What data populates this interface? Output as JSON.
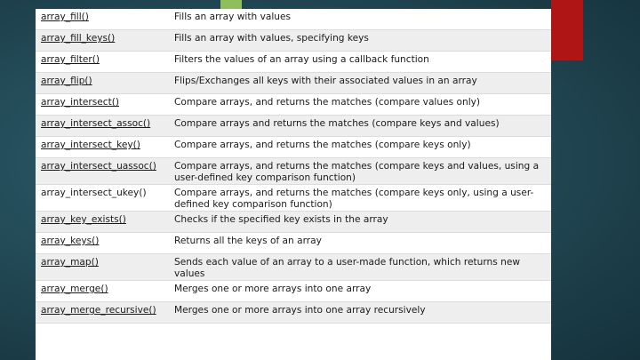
{
  "rows": [
    {
      "fn": "array_fill()",
      "desc": "Fills an array with values",
      "linked": true
    },
    {
      "fn": "array_fill_keys()",
      "desc": "Fills an array with values, specifying keys",
      "linked": true
    },
    {
      "fn": "array_filter()",
      "desc": "Filters the values of an array using a callback function",
      "linked": true
    },
    {
      "fn": "array_flip()",
      "desc": "Flips/Exchanges all keys with their associated values in an array",
      "linked": true
    },
    {
      "fn": "array_intersect()",
      "desc": "Compare arrays, and returns the matches (compare values only)",
      "linked": true
    },
    {
      "fn": "array_intersect_assoc()",
      "desc": "Compare arrays and returns the matches (compare keys and values)",
      "linked": true
    },
    {
      "fn": "array_intersect_key()",
      "desc": "Compare arrays, and returns the matches (compare keys only)",
      "linked": true
    },
    {
      "fn": "array_intersect_uassoc()",
      "desc": "Compare arrays, and returns the matches (compare keys and values, using a user-defined key comparison function)",
      "linked": true
    },
    {
      "fn": "array_intersect_ukey()",
      "desc": "Compare arrays, and returns the matches (compare keys only, using a user-defined key comparison function)",
      "linked": false
    },
    {
      "fn": "array_key_exists()",
      "desc": "Checks if the specified key exists in the array",
      "linked": true
    },
    {
      "fn": "array_keys()",
      "desc": "Returns all the keys of an array",
      "linked": true
    },
    {
      "fn": "array_map()",
      "desc": "Sends each value of an array to a user-made function, which returns new values",
      "linked": true
    },
    {
      "fn": "array_merge()",
      "desc": "Merges one or more arrays into one array",
      "linked": true
    },
    {
      "fn": "array_merge_recursive()",
      "desc": "Merges one or more arrays into one array recursively",
      "linked": true
    }
  ],
  "colors": {
    "accent_red": "#b01516",
    "background": "#234b58",
    "row_alt": "#eeeeee"
  }
}
